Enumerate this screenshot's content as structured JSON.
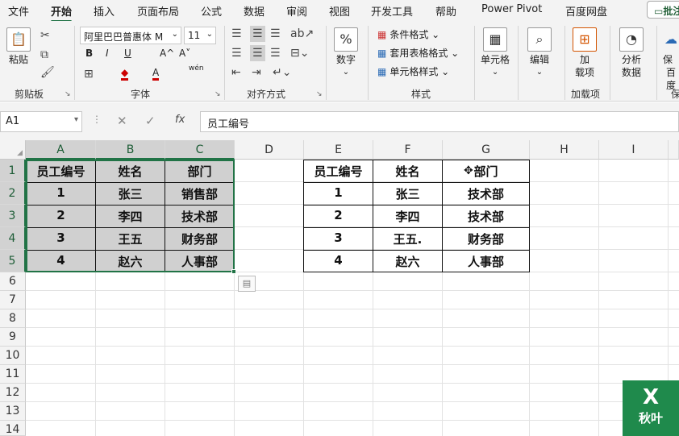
{
  "menubar": {
    "items": [
      "文件",
      "开始",
      "插入",
      "页面布局",
      "公式",
      "数据",
      "审阅",
      "视图",
      "开发工具",
      "帮助",
      "Power Pivot",
      "百度网盘"
    ],
    "active": "开始",
    "comment_button": "批注"
  },
  "ribbon": {
    "clipboard": {
      "paste": "粘贴",
      "label": "剪贴板"
    },
    "font": {
      "name": "阿里巴巴普惠体 M",
      "size": "11",
      "bold": "B",
      "italic": "I",
      "underline": "U",
      "grow": "A^",
      "shrink": "A˅",
      "phonetic": "wén",
      "label": "字体"
    },
    "alignment": {
      "label": "对齐方式"
    },
    "number": {
      "button": "数字",
      "symbol": "%"
    },
    "styles": {
      "conditional": "条件格式",
      "table": "套用表格格式",
      "cell_styles": "单元格样式",
      "label": "样式"
    },
    "cells": {
      "button": "单元格"
    },
    "editing": {
      "button": "编辑"
    },
    "addins": {
      "button_line1": "加",
      "button_line2": "载项",
      "label": "加载项"
    },
    "analysis": {
      "button_line1": "分析",
      "button_line2": "数据"
    },
    "protect": {
      "line1": "保",
      "line2": "百度",
      "label": "保"
    }
  },
  "formula_bar": {
    "name_box": "A1",
    "fx": "fx",
    "content": "员工编号"
  },
  "columns": [
    "A",
    "B",
    "C",
    "D",
    "E",
    "F",
    "G",
    "H",
    "I"
  ],
  "rows": [
    "1",
    "2",
    "3",
    "4",
    "5",
    "6",
    "7",
    "8",
    "9",
    "10",
    "11",
    "12",
    "13",
    "14"
  ],
  "table1": {
    "header": [
      "员工编号",
      "姓名",
      "部门"
    ],
    "rows": [
      [
        "1",
        "张三",
        "销售部"
      ],
      [
        "2",
        "李四",
        "技术部"
      ],
      [
        "3",
        "王五",
        "财务部"
      ],
      [
        "4",
        "赵六",
        "人事部"
      ]
    ]
  },
  "table2": {
    "header": [
      "员工编号",
      "姓名",
      "部门"
    ],
    "rows": [
      [
        "1",
        "张三",
        "技术部"
      ],
      [
        "2",
        "李四",
        "技术部"
      ],
      [
        "3",
        "王五.",
        "财务部"
      ],
      [
        "4",
        "赵六",
        "人事部"
      ]
    ]
  },
  "logo": {
    "text": "秋叶",
    "letter": "X"
  }
}
